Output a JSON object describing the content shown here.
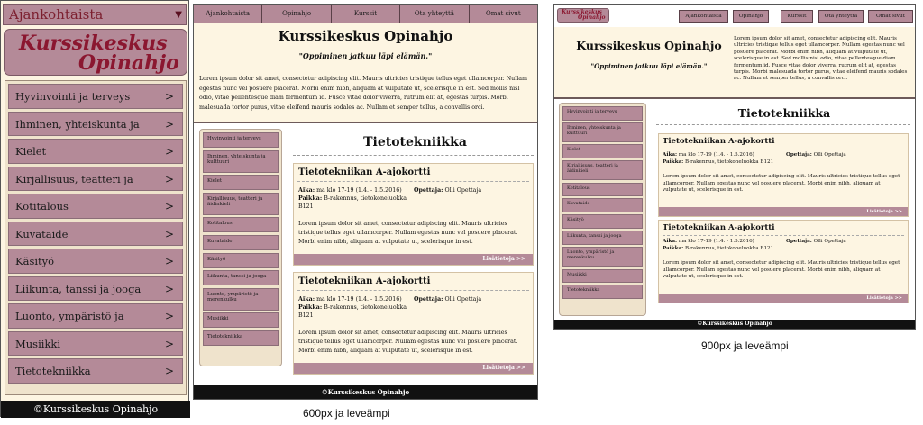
{
  "site": {
    "logo_line1": "Kurssikeskus",
    "logo_line2": "Opinahjo",
    "title": "Kurssikeskus Opinahjo",
    "slogan": "\"Oppiminen jatkuu läpi elämän.\"",
    "footer": "©Kurssikeskus Opinahjo",
    "intro": "Lorem ipsum dolor sit amet, consectetur adipiscing elit. Mauris ultricies tristique tellus eget ullamcorper. Nullam egestas nunc vel posuere placerat. Morbi enim nibh, aliquam at vulputate ut, scelerisque in est. Sed mollis nisl odio, vitae pellentesque diam fermentum id. Fusce vitae dolor viverra, rutrum elit at, egestas turpis. Morbi malesuada tortor purus, vitae eleifend mauris sodales ac. Nullam et semper tellus, a convallis orci."
  },
  "mobile": {
    "select_value": "Ajankohtaista",
    "menu": [
      "Hyvinvointi ja terveys",
      "Ihminen, yhteiskunta ja kulttuuri",
      "Kielet",
      "Kirjallisuus, teatteri ja äidinkieli",
      "Kotitalous",
      "Kuvataide",
      "Käsityö",
      "Liikunta, tanssi ja jooga",
      "Luonto, ympäristö ja merenkulku",
      "Musiikki",
      "Tietotekniikka"
    ],
    "chevron": ">"
  },
  "nav": [
    "Ajankohtaista",
    "Opinahjo",
    "Kurssit",
    "Ota yhteyttä",
    "Omat sivut"
  ],
  "sidebar": [
    "Hyvinvointi ja terveys",
    "Ihminen, yhteiskunta ja kulttuuri",
    "Kielet",
    "Kirjallisuus, teatteri ja äidinkieli",
    "Kotitalous",
    "Kuvataide",
    "Käsityö",
    "Liikunta, tanssi ja jooga",
    "Luonto, ympäristö ja merenkulku",
    "Musiikki",
    "Tietotekniikka"
  ],
  "content": {
    "heading": "Tietotekniikka",
    "cards": [
      {
        "title": "Tietotekniikan A-ajokortti",
        "time_label": "Aika:",
        "time": "ma klo 17-19 (1.4. - 1.5.2016)",
        "place_label": "Paikka:",
        "place": "B-rakennus, tietokoneluokka B121",
        "teacher_label": "Opettaja:",
        "teacher": "Olli Opettaja",
        "body": "Lorem ipsum dolor sit amet, consectetur adipiscing elit. Mauris ultricies tristique tellus eget ullamcorper. Nullam egestas nunc vel posuere placerat. Morbi enim nibh, aliquam at vulputate ut, scelerisque in est.",
        "more": "Lisätietoja >>"
      },
      {
        "title": "Tietotekniikan A-ajokortti",
        "time_label": "Aika:",
        "time": "ma klo 17-19 (1.4. - 1.5.2016)",
        "place_label": "Paikka:",
        "place": "B-rakennus, tietokoneluokka B121",
        "teacher_label": "Opettaja:",
        "teacher": "Olli Opettaja",
        "body": "Lorem ipsum dolor sit amet, consectetur adipiscing elit. Mauris ultricies tristique tellus eget ullamcorper. Nullam egestas nunc vel posuere placerat. Morbi enim nibh, aliquam at vulputate ut, scelerisque in est.",
        "more": "Lisätietoja >>"
      }
    ]
  },
  "captions": {
    "c600": "600px ja leveämpi",
    "c900": "900px ja leveämpi"
  },
  "colors": {
    "accent": "#b48a98",
    "background": "#fdf5e2",
    "logo_text": "#8b1730",
    "footer": "#111111"
  }
}
